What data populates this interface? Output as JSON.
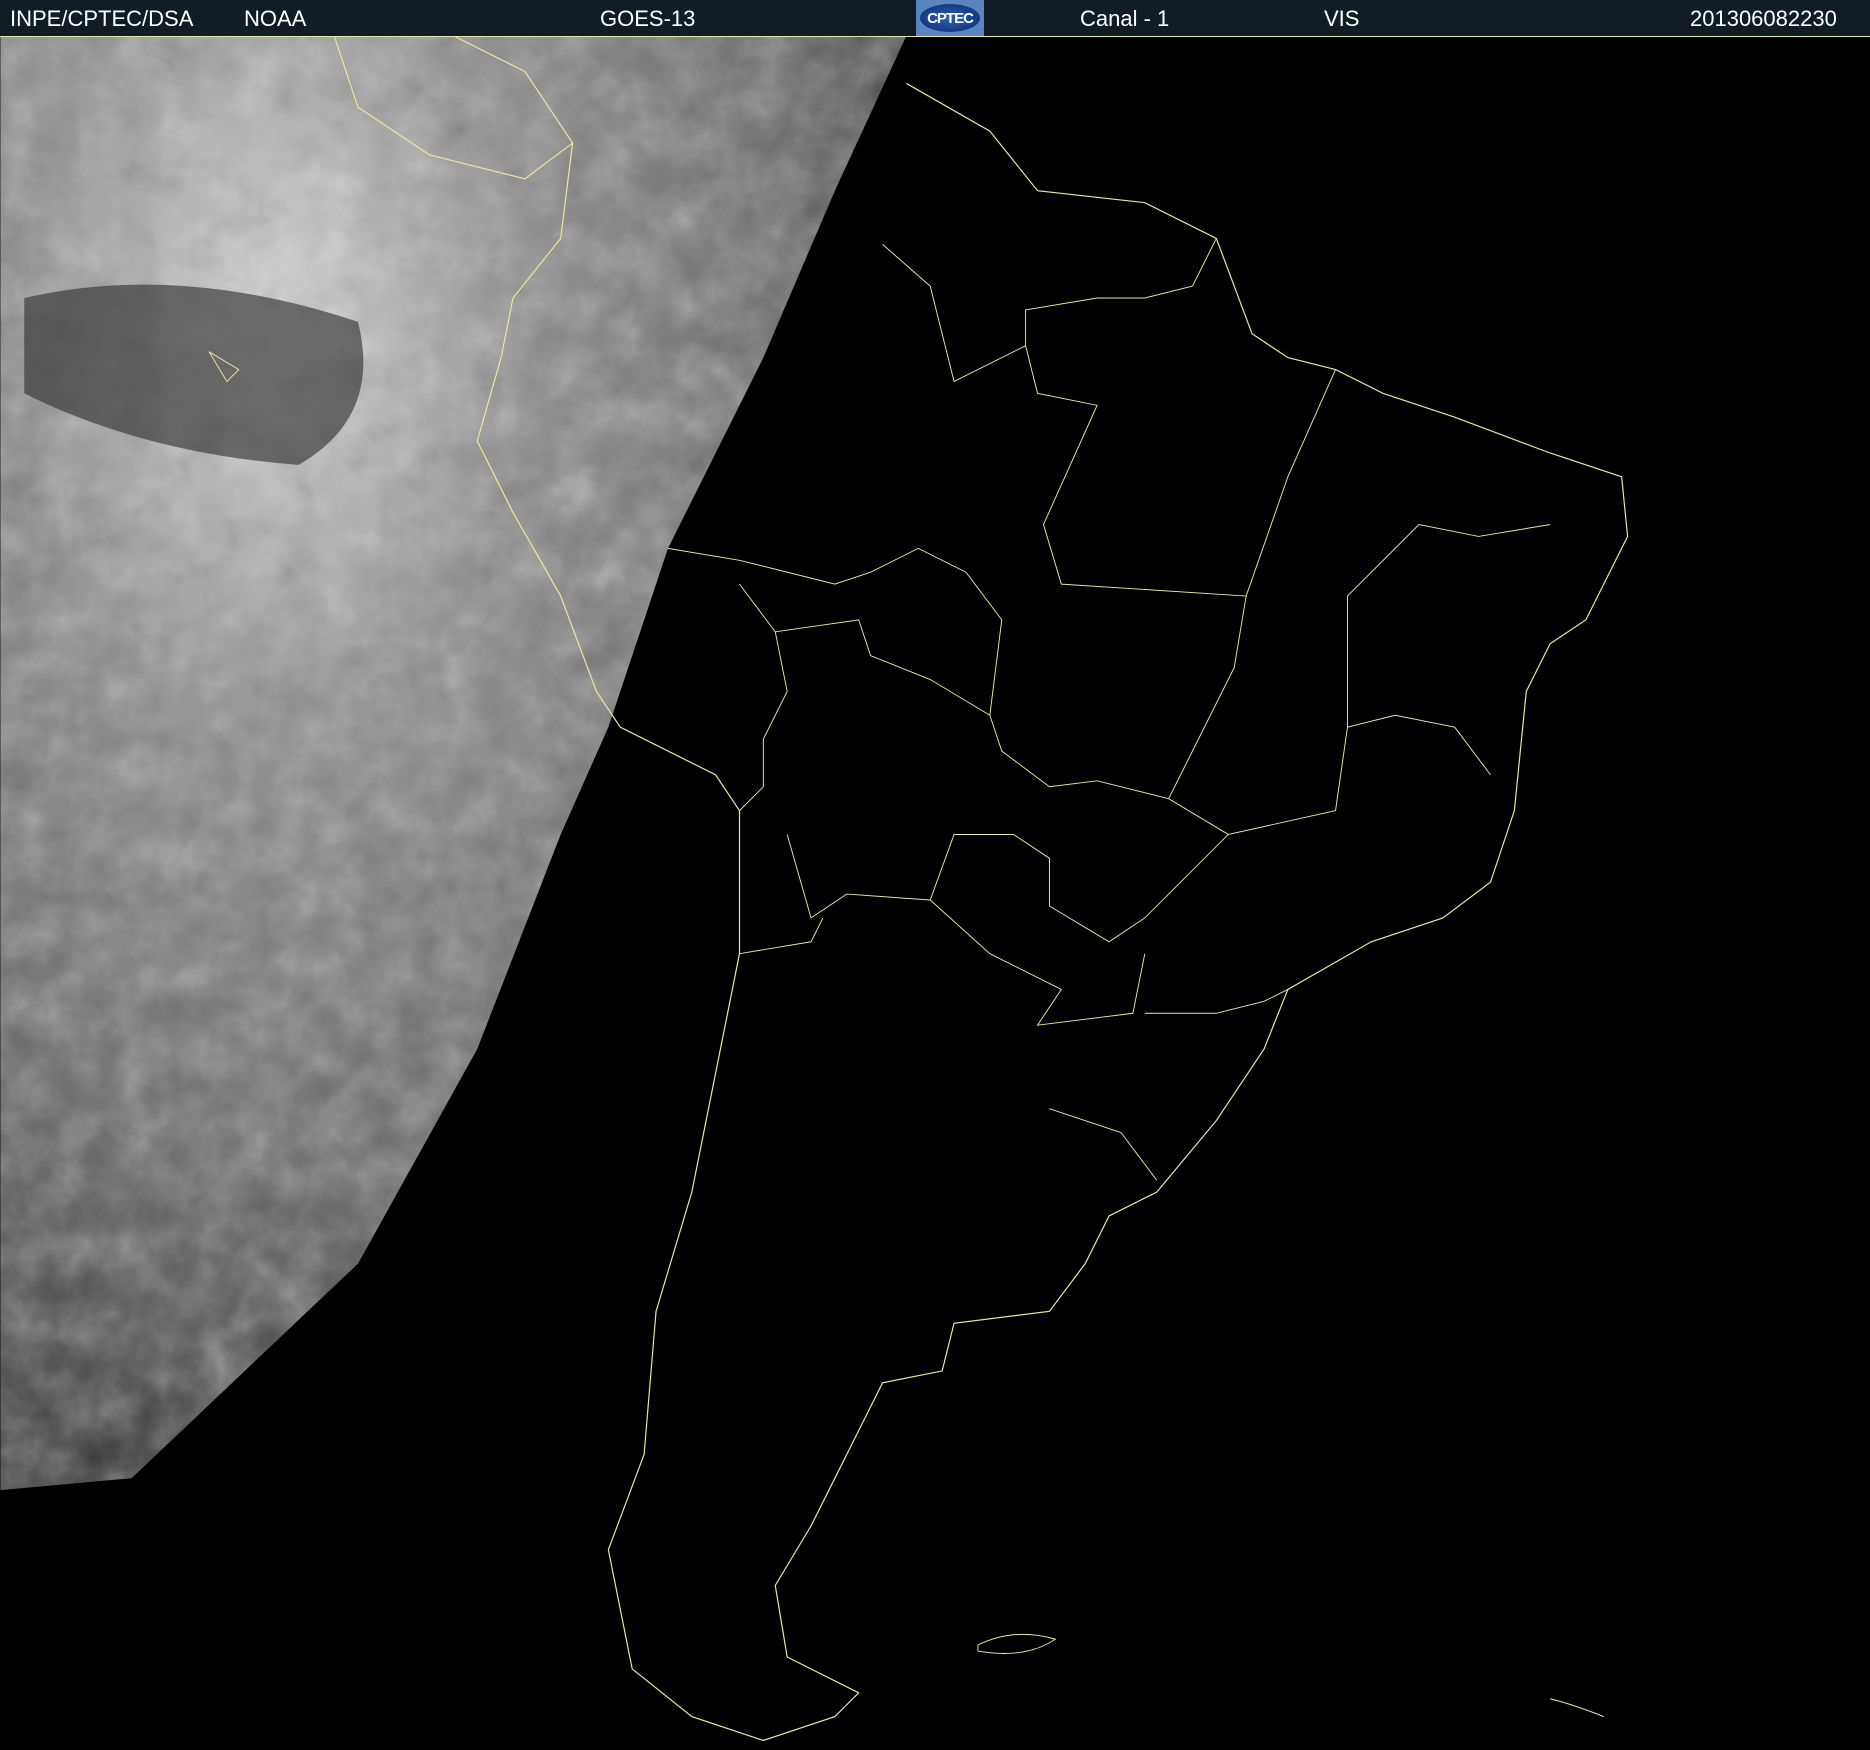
{
  "header": {
    "institution": "INPE/CPTEC/DSA",
    "agency": "NOAA",
    "satellite": "GOES-13",
    "logo_text": "CPTEC",
    "channel": "Canal - 1",
    "band": "VIS",
    "timestamp": "201306082230"
  },
  "colors": {
    "header_bg": "#111c24",
    "coastline": "#e8e8a0",
    "background": "#000000"
  }
}
